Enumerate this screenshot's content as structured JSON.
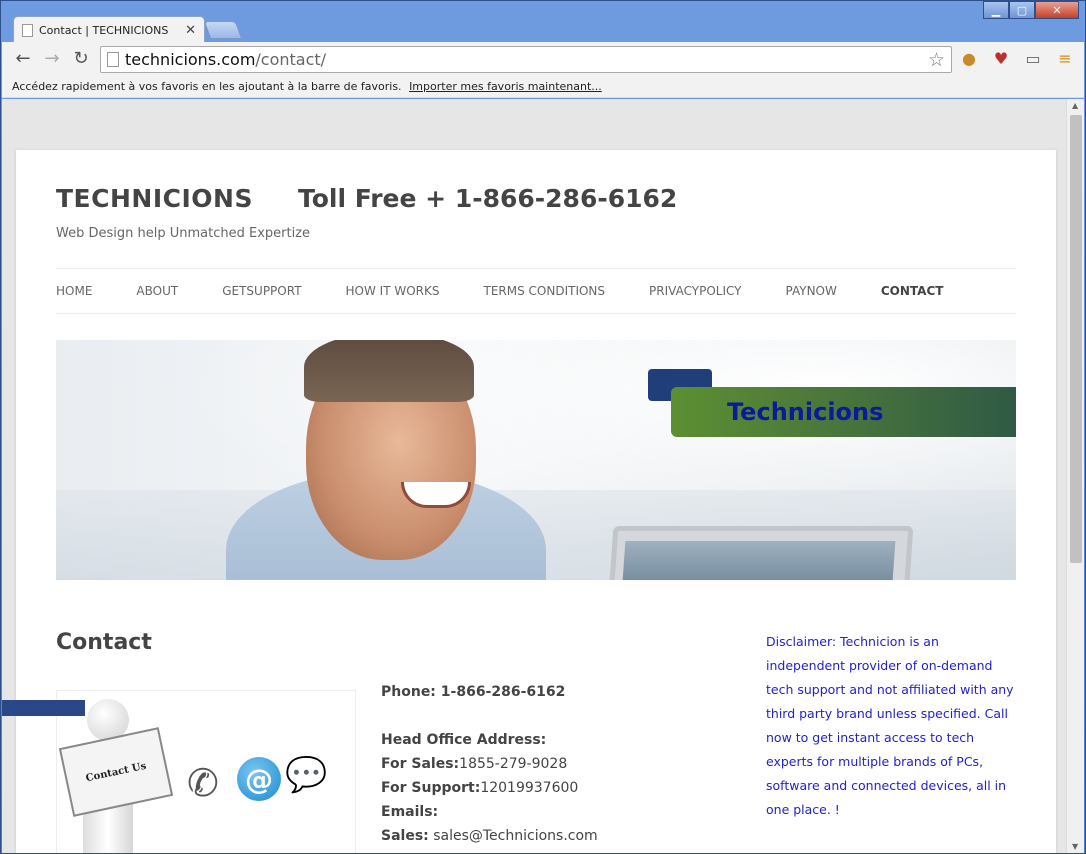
{
  "browser": {
    "tab_title": "Contact | TECHNICIONS",
    "url_host": "technicions.com",
    "url_path": "/contact/",
    "bookmark_prompt": "Accédez rapidement à vos favoris en les ajoutant à la barre de favoris.",
    "bookmark_import": "Importer mes favoris maintenant..."
  },
  "site": {
    "title": "TECHNICIONS",
    "tollfree": "Toll Free + 1-866-286-6162",
    "tagline": "Web Design help Unmatched Expertize"
  },
  "nav": [
    "HOME",
    "ABOUT",
    "GETSUPPORT",
    "HOW IT WORKS",
    "TERMS CONDITIONS",
    "PRIVACYPOLICY",
    "PAYNOW",
    "CONTACT"
  ],
  "banner": {
    "brand": "Technicions"
  },
  "contact": {
    "heading": "Contact",
    "image_sign": "Contact Us",
    "phone_label": "Phone: 1-866-286-6162",
    "head_office_label": "Head Office Address:",
    "sales_label": "For Sales:",
    "sales_value": "1855-279-9028",
    "support_label": "For Support:",
    "support_value": "12019937600",
    "emails_label": "Emails:",
    "sales_email_label": "Sales:",
    "sales_email_value": " sales@Technicions.com"
  },
  "disclaimer": "Disclaimer: Technicion is an independent provider of on-demand tech support and not affiliated with any third party brand unless specified. Call now to get instant access to tech experts for multiple brands of PCs, software and connected devices, all in one place. !",
  "colors": {
    "accent_blue": "#1f3e7a",
    "disclaimer_text": "#2222cc",
    "banner_green": "#5c8f32"
  }
}
